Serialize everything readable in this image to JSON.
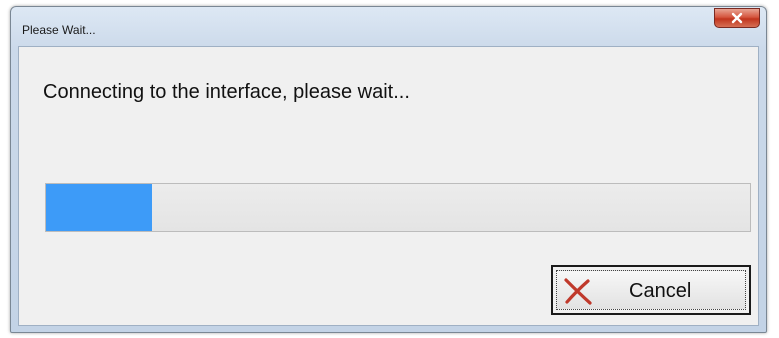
{
  "window": {
    "title": "Please Wait...",
    "close_symbol": "x"
  },
  "dialog": {
    "message": "Connecting to the interface, please wait...",
    "progress_fraction": 0.15
  },
  "buttons": {
    "cancel_label": "Cancel",
    "cancel_icon": "red-x-icon"
  },
  "colors": {
    "progress_fill": "#3d9bf8",
    "cancel_icon": "#c0392b"
  }
}
